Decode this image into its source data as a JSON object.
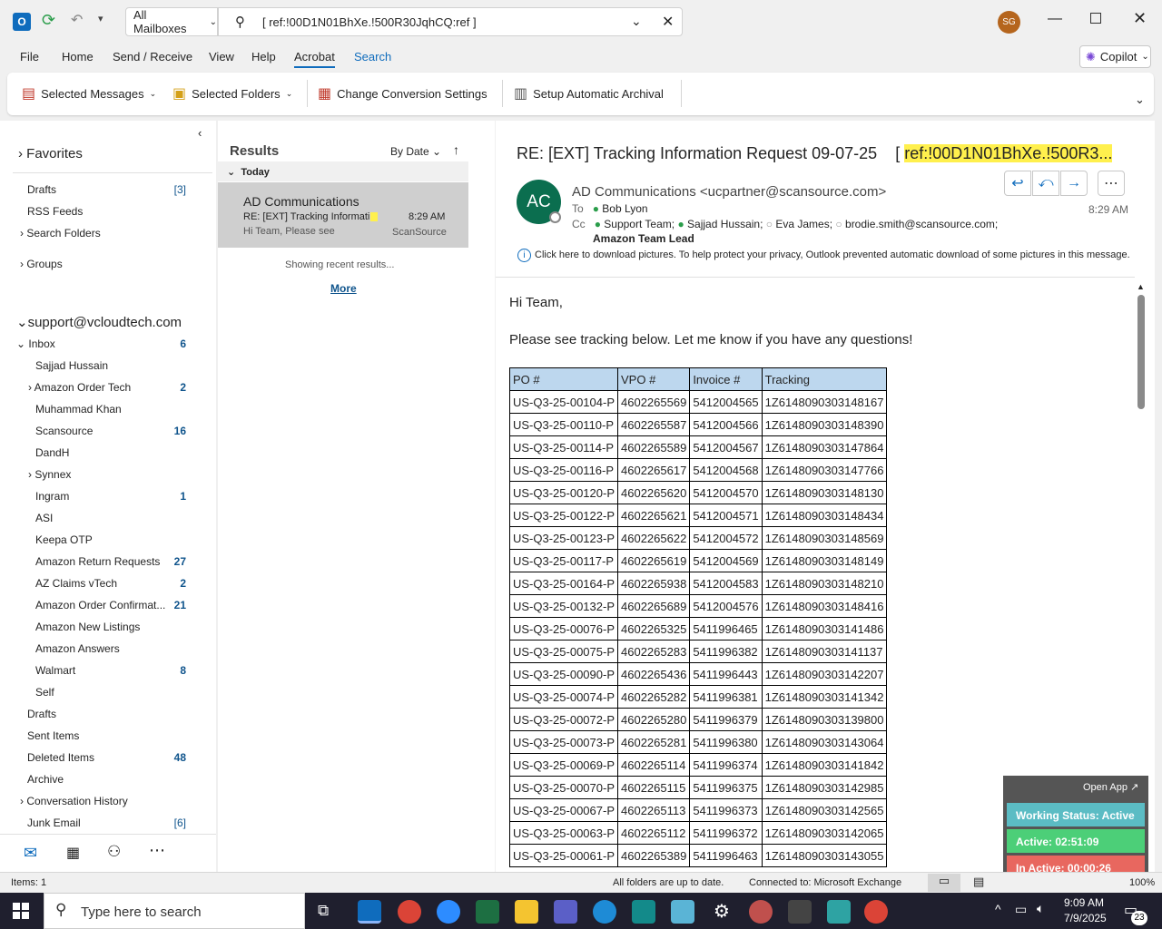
{
  "titlebar": {
    "mailbox_scope": "All Mailboxes",
    "search_value": "[ ref:!00D1N01BhXe.!500R30JqhCQ:ref ]",
    "avatar_initials": "SG"
  },
  "menu": [
    "File",
    "Home",
    "Send / Receive",
    "View",
    "Help",
    "Acrobat",
    "Search"
  ],
  "copilot_label": "Copilot",
  "ribbon": {
    "selected_messages": "Selected Messages",
    "selected_folders": "Selected Folders",
    "change_conversion": "Change Conversion Settings",
    "setup_archival": "Setup Automatic Archival"
  },
  "folders": {
    "favorites": "Favorites",
    "drafts_fav": "Drafts",
    "drafts_fav_count": "[3]",
    "rss": "RSS Feeds",
    "search_folders": "Search Folders",
    "groups": "Groups",
    "account": "support@vcloudtech.com",
    "inbox": "Inbox",
    "inbox_count": "6",
    "items": [
      {
        "label": "Sajjad Hussain",
        "count": ""
      },
      {
        "label": "Amazon Order Tech",
        "count": "2"
      },
      {
        "label": "Muhammad Khan",
        "count": ""
      },
      {
        "label": "Scansource",
        "count": "16"
      },
      {
        "label": "DandH",
        "count": ""
      },
      {
        "label": "Synnex",
        "count": ""
      },
      {
        "label": "Ingram",
        "count": "1"
      },
      {
        "label": "ASI",
        "count": ""
      },
      {
        "label": "Keepa OTP",
        "count": ""
      },
      {
        "label": "Amazon Return Requests",
        "count": "27"
      },
      {
        "label": "AZ Claims vTech",
        "count": "2"
      },
      {
        "label": "Amazon Order Confirmat...",
        "count": "21"
      },
      {
        "label": "Amazon New Listings",
        "count": ""
      },
      {
        "label": "Amazon Answers",
        "count": ""
      },
      {
        "label": "Walmart",
        "count": "8"
      },
      {
        "label": "Self",
        "count": ""
      }
    ],
    "drafts": "Drafts",
    "sent": "Sent Items",
    "deleted": "Deleted Items",
    "deleted_count": "48",
    "archive": "Archive",
    "conversation_history": "Conversation History",
    "junk": "Junk Email",
    "junk_count": "[6]"
  },
  "list": {
    "heading": "Results",
    "sort": "By Date",
    "group": "Today",
    "sender": "AD Communications",
    "subject": "RE: [EXT] Tracking Informati...",
    "time": "8:29 AM",
    "preview": "Hi Team,  Please see",
    "source": "ScanSource",
    "showing": "Showing recent results...",
    "more": "More"
  },
  "email": {
    "subject": "RE: [EXT] Tracking Information Request  09-07-25",
    "subject_ref": "ref:!00D1N01BhXe.!500R3...",
    "avatar": "AC",
    "from": "AD Communications <ucpartner@scansource.com>",
    "to_label": "To",
    "to": "Bob Lyon",
    "cc_label": "Cc",
    "cc1": "Support Team;",
    "cc2": "Sajjad Hussain;",
    "cc3": "Eva James;",
    "cc4": "brodie.smith@scansource.com;",
    "cc5": "Amazon Team Lead",
    "time": "8:29 AM",
    "info": "Click here to download pictures. To help protect your privacy, Outlook prevented automatic download of some pictures in this message.",
    "greeting": "Hi Team,",
    "body": "Please see tracking below. Let me know if you have any questions!",
    "table_headers": [
      "PO #",
      "VPO #",
      "Invoice #",
      "Tracking"
    ],
    "rows": [
      [
        "US-Q3-25-00104-P",
        "4602265569",
        "5412004565",
        "1Z6148090303148167"
      ],
      [
        "US-Q3-25-00110-P",
        "4602265587",
        "5412004566",
        "1Z6148090303148390"
      ],
      [
        "US-Q3-25-00114-P",
        "4602265589",
        "5412004567",
        "1Z6148090303147864"
      ],
      [
        "US-Q3-25-00116-P",
        "4602265617",
        "5412004568",
        "1Z6148090303147766"
      ],
      [
        "US-Q3-25-00120-P",
        "4602265620",
        "5412004570",
        "1Z6148090303148130"
      ],
      [
        "US-Q3-25-00122-P",
        "4602265621",
        "5412004571",
        "1Z6148090303148434"
      ],
      [
        "US-Q3-25-00123-P",
        "4602265622",
        "5412004572",
        "1Z6148090303148569"
      ],
      [
        "US-Q3-25-00117-P",
        "4602265619",
        "5412004569",
        "1Z6148090303148149"
      ],
      [
        "US-Q3-25-00164-P",
        "4602265938",
        "5412004583",
        "1Z6148090303148210"
      ],
      [
        "US-Q3-25-00132-P",
        "4602265689",
        "5412004576",
        "1Z6148090303148416"
      ],
      [
        "US-Q3-25-00076-P",
        "4602265325",
        "5411996465",
        "1Z6148090303141486"
      ],
      [
        "US-Q3-25-00075-P",
        "4602265283",
        "5411996382",
        "1Z6148090303141137"
      ],
      [
        "US-Q3-25-00090-P",
        "4602265436",
        "5411996443",
        "1Z6148090303142207"
      ],
      [
        "US-Q3-25-00074-P",
        "4602265282",
        "5411996381",
        "1Z6148090303141342"
      ],
      [
        "US-Q3-25-00072-P",
        "4602265280",
        "5411996379",
        "1Z6148090303139800"
      ],
      [
        "US-Q3-25-00073-P",
        "4602265281",
        "5411996380",
        "1Z6148090303143064"
      ],
      [
        "US-Q3-25-00069-P",
        "4602265114",
        "5411996374",
        "1Z6148090303141842"
      ],
      [
        "US-Q3-25-00070-P",
        "4602265115",
        "5411996375",
        "1Z6148090303142985"
      ],
      [
        "US-Q3-25-00067-P",
        "4602265113",
        "5411996373",
        "1Z6148090303142565"
      ],
      [
        "US-Q3-25-00063-P",
        "4602265112",
        "5411996372",
        "1Z6148090303142065"
      ],
      [
        "US-Q3-25-00061-P",
        "4602265389",
        "5411996463",
        "1Z6148090303143055"
      ]
    ]
  },
  "widget": {
    "open_app": "Open App ↗",
    "working": "Working Status: Active",
    "active": "Active: 02:51:09",
    "inactive": "In Active: 00:00:26"
  },
  "status": {
    "items": "Items: 1",
    "uptodate": "All folders are up to date.",
    "connected": "Connected to: Microsoft Exchange",
    "zoom": "100%"
  },
  "taskbar": {
    "search_placeholder": "Type here to search",
    "time": "9:09 AM",
    "date": "7/9/2025",
    "notif_count": "23"
  },
  "colors": {
    "accent": "#0f6cbd",
    "highlight": "#fff04d",
    "table_header": "#bdd7ee",
    "widget_teal": "#5bbcc4",
    "widget_green": "#4ccf78",
    "widget_red": "#e8675f"
  }
}
